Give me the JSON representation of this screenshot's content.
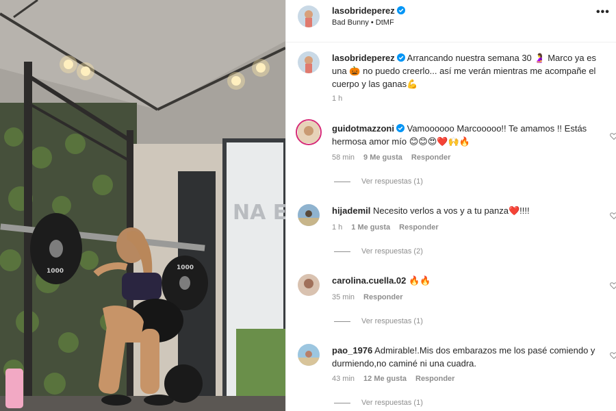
{
  "post": {
    "username": "lasobrideperez",
    "audio": "Bad Bunny • DtMF",
    "caption_text": "Arrancando nuestra semana 30 🤰 Marco ya es una 🎃 no puedo creerlo... así me verán mientras me acompañe el cuerpo y las ganas💪",
    "caption_time": "1 h",
    "more_icon": "more-horizontal-icon",
    "verified_icon": "verified-badge-icon"
  },
  "comments": [
    {
      "username": "guidotmazzoni",
      "verified": true,
      "text": "Vamoooooo Marcooooo!! Te amamos !! Estás hermosa amor mío 😊😊😍❤️🙌🔥",
      "time": "58 min",
      "likes": "9 Me gusta",
      "reply": "Responder",
      "view_replies": "Ver respuestas (1)"
    },
    {
      "username": "hijademil",
      "verified": false,
      "text": "Necesito verlos a vos y a tu panza❤️!!!!",
      "time": "1 h",
      "likes": "1 Me gusta",
      "reply": "Responder",
      "view_replies": "Ver respuestas (2)"
    },
    {
      "username": "carolina.cuella.02",
      "verified": false,
      "text": "🔥🔥",
      "time": "35 min",
      "likes": "",
      "reply": "Responder",
      "view_replies": "Ver respuestas (1)"
    },
    {
      "username": "pao_1976",
      "verified": false,
      "text": "Admirable!.Mis dos embarazos me los pasé comiendo y durmiendo,no caminé ni una cuadra.",
      "time": "43 min",
      "likes": "12 Me gusta",
      "reply": "Responder",
      "view_replies": "Ver respuestas (1)"
    }
  ],
  "media": {
    "plate_label_left": "1000",
    "plate_label_right": "1000",
    "wall_text": "NA E TI O"
  },
  "colors": {
    "text": "#262626",
    "muted": "#8e8e8e",
    "verified_blue": "#0095f6",
    "divider": "#efefef"
  }
}
